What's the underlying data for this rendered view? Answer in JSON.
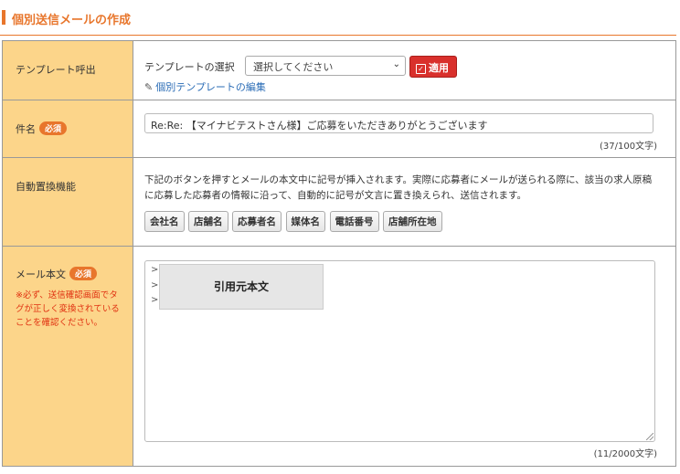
{
  "page": {
    "title": "個別送信メールの作成"
  },
  "template": {
    "label": "テンプレート呼出",
    "select_label": "テンプレートの選択",
    "select_value": "選択してください",
    "apply_label": "適用",
    "edit_link": "個別テンプレートの編集"
  },
  "subject": {
    "label": "件名",
    "required": "必須",
    "value": "Re:Re: 【マイナビテストさん様】ご応募をいただきありがとうございます",
    "counter": "(37/100文字)"
  },
  "auto_replace": {
    "label": "自動置換機能",
    "description": "下記のボタンを押すとメールの本文中に記号が挿入されます。実際に応募者にメールが送られる際に、該当の求人原稿に応募した応募者の情報に沿って、自動的に記号が文言に置き換えられ、送信されます。",
    "buttons": [
      "会社名",
      "店舗名",
      "応募者名",
      "媒体名",
      "電話番号",
      "店舗所在地"
    ]
  },
  "body": {
    "label": "メール本文",
    "required": "必須",
    "note": "※必ず、送信確認画面でタグが正しく変換されていることを確認ください。",
    "quote_marks": [
      ">",
      ">",
      ">"
    ],
    "quote_label": "引用元本文",
    "counter": "(11/2000文字)"
  }
}
